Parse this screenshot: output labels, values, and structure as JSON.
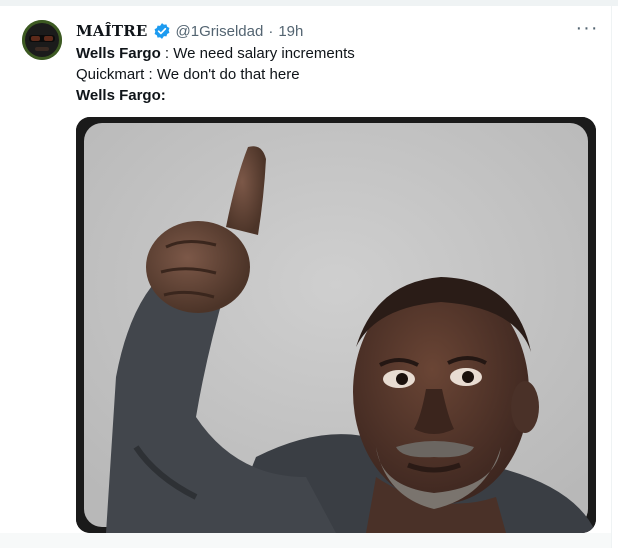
{
  "tweet": {
    "author": {
      "display_name": "MAÎTRE",
      "handle": "@1Griseldad",
      "time_separator": "·",
      "time": "19h",
      "verified_icon": "verified-badge-icon",
      "avatar_icon": "avatar"
    },
    "more_icon": "more-horizontal-icon",
    "lines": [
      {
        "speaker": "Wells Fargo",
        "separator": " : ",
        "text": "We need salary increments"
      },
      {
        "speaker": "Quickmart",
        "separator": " : ",
        "text": "We don't do that here"
      },
      {
        "speaker": "Wells Fargo",
        "separator": ":",
        "text": ""
      }
    ]
  },
  "colors": {
    "text_primary": "#0f1419",
    "text_secondary": "#536471",
    "verified_blue": "#1d9bf0",
    "divider": "#eff3f4"
  }
}
